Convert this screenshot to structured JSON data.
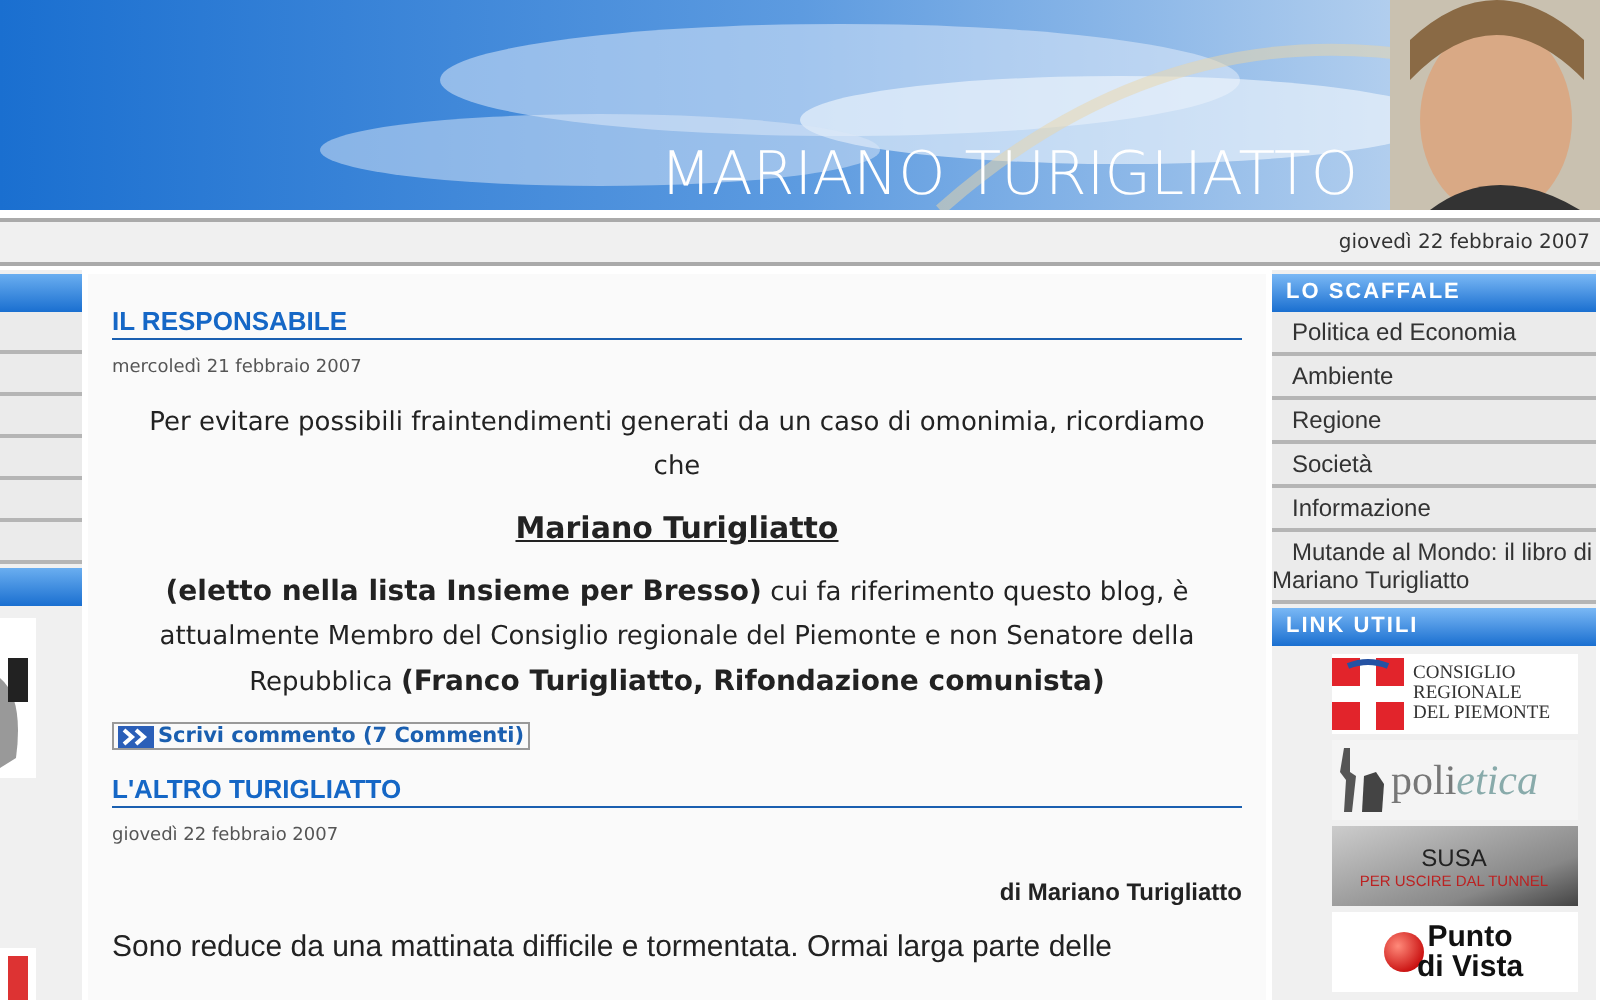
{
  "header": {
    "title": "MARIANO TURIGLIATTO"
  },
  "date_bar": {
    "date": "giovedì 22 febbraio 2007"
  },
  "posts": [
    {
      "title": "IL RESPONSABILE",
      "date": "mercoledì 21 febbraio 2007",
      "paragraphs": [
        {
          "kind": "lead",
          "text": "Per evitare possibili fraintendimenti generati da un caso di omonimia, ricordiamo che"
        },
        {
          "kind": "name",
          "text": "Mariano Turigliatto"
        },
        {
          "kind": "lead",
          "text": "**(eletto nella lista Insieme per Bresso)** cui fa riferimento questo blog, è attualmente Membro del Consiglio regionale del Piemonte e non Senatore della Repubblica  **(Franco Turigliatto, Rifondazione comunista)**"
        }
      ],
      "comment_link": "Scrivi commento (7 Commenti)"
    },
    {
      "title": "L'ALTRO TURIGLIATTO",
      "date": "giovedì 22 febbraio 2007",
      "paragraphs": [
        {
          "kind": "byline",
          "text": "di Mariano Turigliatto"
        },
        {
          "kind": "body",
          "text": "Sono reduce da una mattinata difficile e tormentata. Ormai larga parte delle"
        }
      ]
    }
  ],
  "right_sidebar": [
    {
      "kind": "list",
      "title": "LO SCAFFALE",
      "items": [
        "Politica ed Economia",
        "Ambiente",
        "Regione",
        "Società",
        "Informazione",
        "Mutande al Mondo: il libro di Mariano Turigliatto"
      ]
    },
    {
      "kind": "banners",
      "title": "LINK UTILI",
      "banners": [
        {
          "kind": "consiglio",
          "lines": [
            "CONSIGLIO",
            "REGIONALE",
            "DEL PIEMONTE"
          ]
        },
        {
          "kind": "polietica",
          "lines": [
            "poli",
            "etica"
          ]
        },
        {
          "kind": "susa",
          "lines": [
            "SUSA",
            "PER USCIRE DAL TUNNEL"
          ]
        },
        {
          "kind": "puntodivista",
          "lines": [
            "Punto",
            "di Vista"
          ]
        }
      ]
    }
  ]
}
